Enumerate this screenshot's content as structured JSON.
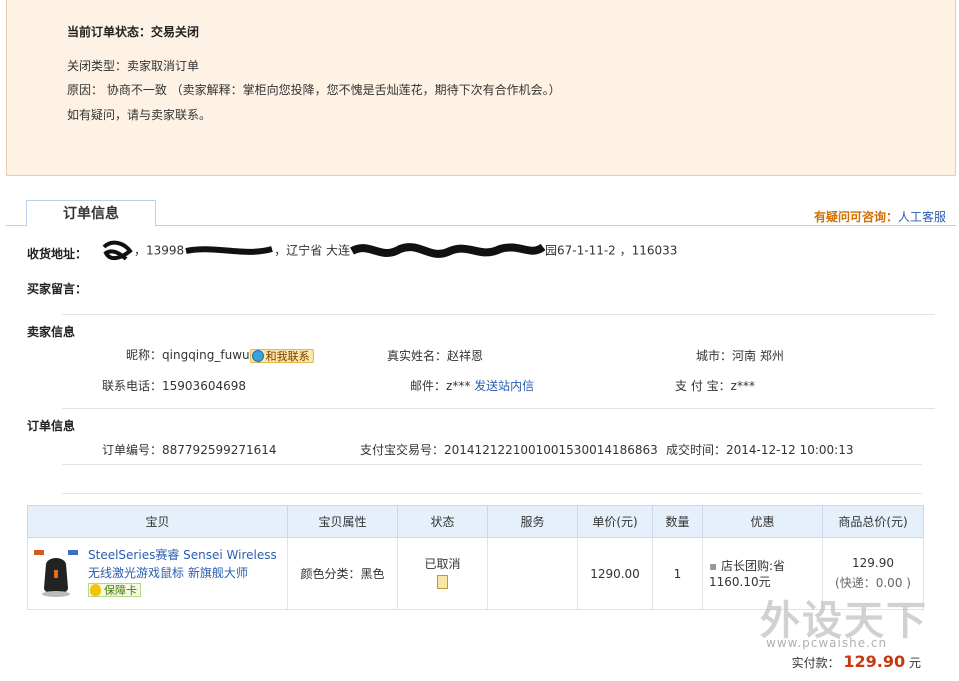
{
  "status": {
    "title": "当前订单状态：交易关闭",
    "close_type": "关闭类型：卖家取消订单",
    "reason": "原因： 协商不一致 （卖家解释：掌柜向您投降，您不愧是舌灿莲花，期待下次有合作机会。）",
    "contact_hint": "如有疑问，请与卖家联系。"
  },
  "tab": {
    "label": "订单信息"
  },
  "help": {
    "question": "有疑问可咨询：",
    "link": "人工客服"
  },
  "address": {
    "label": "收货地址：",
    "phone_prefix": "，13998",
    "province": "，辽宁省 大连",
    "suffix": "园67-1-11-2 ，116033"
  },
  "buyer_message": {
    "label": "买家留言："
  },
  "seller": {
    "section_title": "卖家信息",
    "nickname_label": "昵称：",
    "nickname": "qingqing_fuwu",
    "contact_button": "和我联系",
    "realname_label": "真实姓名：",
    "realname": "赵祥恩",
    "city_label": "城市：",
    "city": "河南 郑州",
    "phone_label": "联系电话：",
    "phone": "15903604698",
    "email_label": "邮件：",
    "email": "z***",
    "send_message": "发送站内信",
    "alipay_label": "支 付 宝：",
    "alipay": "z***"
  },
  "order": {
    "section_title": "订单信息",
    "order_no_label": "订单编号：",
    "order_no": "887792599271614",
    "alipay_no_label": "支付宝交易号：",
    "alipay_no": "2014121221001001530014186863",
    "deal_time_label": "成交时间：",
    "deal_time": "2014-12-12 10:00:13"
  },
  "table": {
    "headers": [
      "宝贝",
      "宝贝属性",
      "状态",
      "服务",
      "单价(元)",
      "数量",
      "优惠",
      "商品总价(元)"
    ],
    "row": {
      "title": "SteelSeries赛睿 Sensei Wireless无线激光游戏鼠标 新旗舰大师",
      "guarantee": "保障卡",
      "attribute": "颜色分类：黑色",
      "status": "已取消",
      "service": "",
      "unit_price": "1290.00",
      "quantity": "1",
      "discount": "店长团购:省1160.10元",
      "total": "129.90",
      "shipping": "(快递：0.00 )"
    }
  },
  "payment": {
    "label": "实付款：",
    "amount": "129.90",
    "unit": "元"
  },
  "watermark": {
    "cn": "外设天下",
    "en": "www.pcwaishe.cn"
  },
  "colors": {
    "accent": "#2a5db0",
    "help": "#d36f00",
    "price": "#c8380f",
    "status_bg": "#fdf2e3"
  }
}
